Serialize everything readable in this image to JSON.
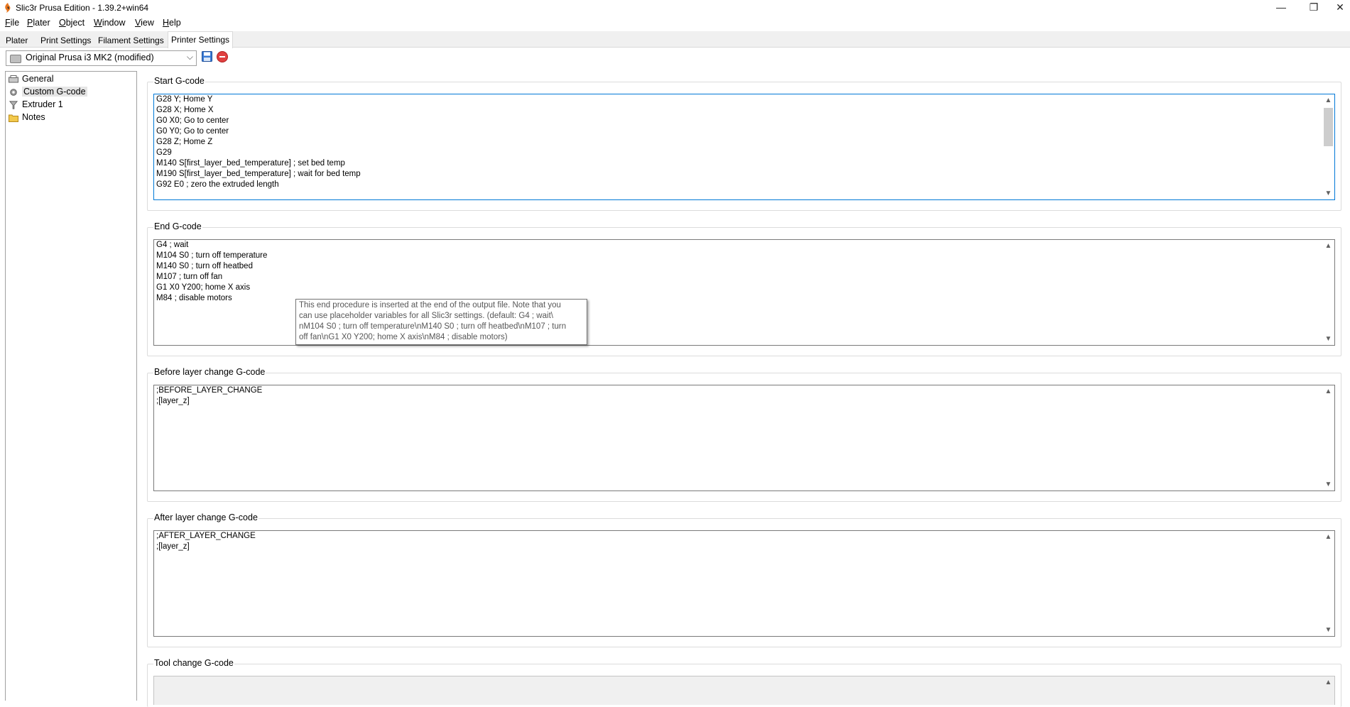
{
  "window": {
    "title": "Slic3r Prusa Edition - 1.39.2+win64",
    "minimize_icon": "minimize-icon",
    "restore_icon": "restore-icon",
    "close_icon": "close-icon",
    "minimize_glyph": "—",
    "restore_glyph": "❐",
    "close_glyph": "✕"
  },
  "menu": [
    {
      "first": "F",
      "rest": "ile"
    },
    {
      "first": "P",
      "rest": "later"
    },
    {
      "first": "O",
      "rest": "bject"
    },
    {
      "first": "W",
      "rest": "indow"
    },
    {
      "first": "V",
      "rest": "iew"
    },
    {
      "first": "H",
      "rest": "elp"
    }
  ],
  "tabs": [
    "Plater",
    "Print Settings",
    "Filament Settings",
    "Printer Settings"
  ],
  "active_tab": "Printer Settings",
  "preset": {
    "selected": "Original Prusa i3 MK2 (modified)",
    "chevron": "⌵"
  },
  "sidebar": {
    "items": [
      {
        "label": "General",
        "icon": "printer-icon"
      },
      {
        "label": "Custom G-code",
        "icon": "cog-icon"
      },
      {
        "label": "Extruder 1",
        "icon": "funnel-icon"
      },
      {
        "label": "Notes",
        "icon": "folder-icon"
      }
    ],
    "selected": "Custom G-code"
  },
  "sections": {
    "start": {
      "title": "Start G-code",
      "lines": [
        "G28 Y; Home Y",
        "G28 X; Home X",
        "G0 X0; Go to center",
        "G0 Y0; Go to center",
        "G28 Z; Home Z",
        "G29",
        "M140 S[first_layer_bed_temperature] ; set bed temp",
        "M190 S[first_layer_bed_temperature] ; wait for bed temp",
        "G92 E0 ; zero the extruded length"
      ]
    },
    "end": {
      "title": "End G-code",
      "lines": [
        "G4 ; wait",
        "M104 S0 ; turn off temperature",
        "M140 S0 ; turn off heatbed",
        "M107 ; turn off fan",
        "G1 X0 Y200; home X axis",
        "M84 ; disable motors"
      ]
    },
    "before_layer": {
      "title": "Before layer change G-code",
      "lines": [
        ";BEFORE_LAYER_CHANGE",
        ";[layer_z]"
      ]
    },
    "after_layer": {
      "title": "After layer change G-code",
      "lines": [
        ";AFTER_LAYER_CHANGE",
        ";[layer_z]"
      ]
    },
    "tool_change": {
      "title": "Tool change G-code",
      "lines": []
    }
  },
  "tooltip": {
    "lines": [
      "This end procedure is inserted at the end of the output file. Note that you",
      "can use placeholder variables for all Slic3r settings. (default: G4 ; wait\\",
      "nM104 S0 ; turn off temperature\\nM140 S0 ; turn off heatbed\\nM107 ; turn",
      "off fan\\nG1 X0 Y200; home X axis\\nM84 ; disable motors)"
    ]
  },
  "colors": {
    "focus_border": "#0078d7",
    "delete_button": "#e04040",
    "save_button": "#3a7bd5",
    "app_icon": "#e8761e"
  }
}
